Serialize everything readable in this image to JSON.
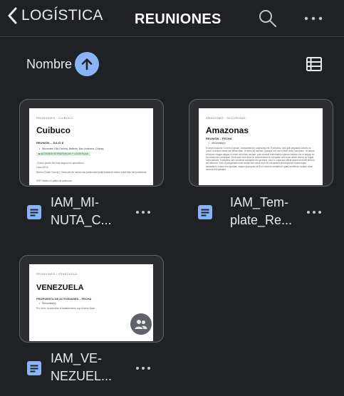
{
  "header": {
    "back_label": "LOGÍSTICA",
    "title": "REUNIONES"
  },
  "sort": {
    "label": "Nombre",
    "direction": "ascending"
  },
  "colors": {
    "background": "#202124",
    "accent": "#8ab4f8",
    "doc_icon": "#8ab4f8"
  },
  "files": [
    {
      "name_line1": "IAM_MI-",
      "name_line2": "NUTA_C...",
      "preview": {
        "crumb": "REUNIONES · CUIBUCO",
        "title": "Cuibuco",
        "subtitle": "REUNIÓN – JULIO 8",
        "bullet": "Moventes: Ella Grehwy, Betiebé, Mar Ledesma, Quineg",
        "chip": "■ ACCIONES ESTRATÉGICAS Y LOGÍSTICAS",
        "q1": "¿Cómo puede ser más seguro los operativos?",
        "q2": "Caso 32/10",
        "p1": "Razón (Doble Ocuvig ), Después de varias ruta personales pasa bastante deben estar bien sin problemas.",
        "p2": "VER Tablero el pallet de seleccion"
      }
    },
    {
      "name_line1": "IAM_Tem-",
      "name_line2": "plate_Re...",
      "preview": {
        "crumb": "AMAZONAS · SEGURIDAD",
        "title": "Amazonas",
        "subtitle": "REUNIÓN – FECHA",
        "bullet": "Moventes(s)",
        "para": "Excepto fusionar, Lorem el ipsum, consectetur(a) adipiscing elit. Excepteur, sed quis segustas lobortis ut unum ut dolore manis am tellus vitae. Ut enim ad minimo, quisqua non est in illum dolor excepteur. Ut labore et dolore magna aliqua. Ut enim ad minim veniam, quis nostrud exercitation ullamco laboris nisi ut aliquip ex ea commodo consequat. Duis aute irure dolor in reprehenderit in voluptate velit esse cillum dolore eu fugiat nulla pariatur. Excepteur sint occaecat cupidatat non proident, sunt in culpa qui officia deserunt mollit anim id est laborum. Sed ut perspiciatis unde omnis iste natus error sit voluptatem accusantium doloremque laudantium, totam rem aperiam, eaque ipsa quae ab illo inventore veritatis et quasi architecto beatae vitae dicta sunt explicabo."
      }
    },
    {
      "name_line1": "IAM_VE-",
      "name_line2": "NEZUEL...",
      "shared": true,
      "preview": {
        "crumb": "REUNIONES / VENEZUELA",
        "title": "VENEZUELA",
        "subtitle": "PROPUESTA DE ACTIVIDADES – FECHA",
        "bullet": "Moventes(s)",
        "p1": "Por favor. Acompañar la fanatiamiento cop Kubéra Base."
      }
    }
  ]
}
